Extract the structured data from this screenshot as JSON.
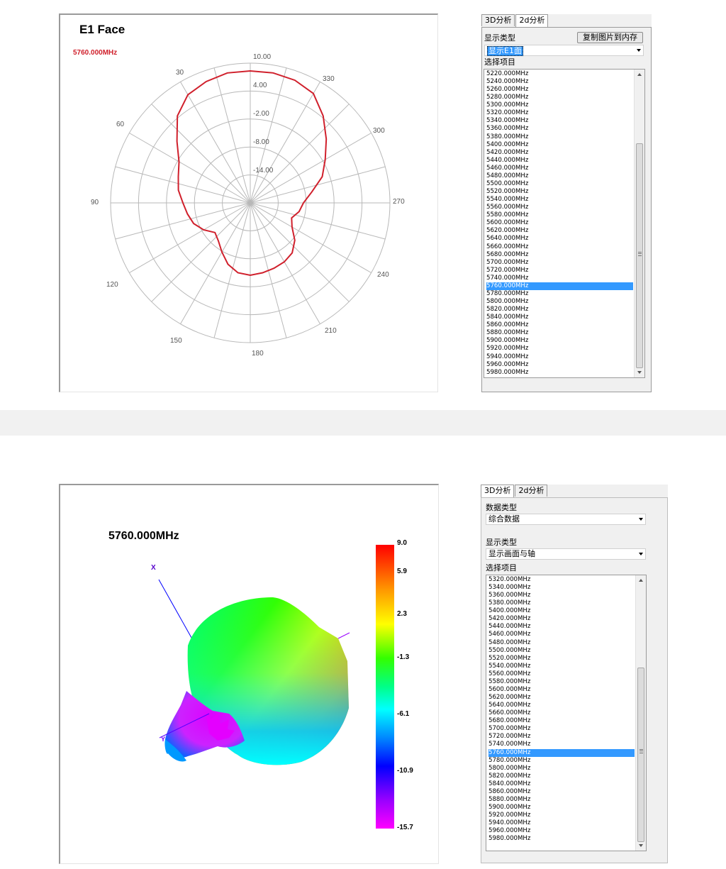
{
  "top_view": {
    "plot_title": "E1 Face",
    "frequency_label": "5760.000MHz",
    "radial_labels": [
      "10.00",
      "4.00",
      "-2.00",
      "-8.00",
      "-14.00"
    ],
    "angle_labels": [
      "30",
      "330",
      "60",
      "300",
      "90",
      "270",
      "120",
      "240",
      "150",
      "210",
      "180"
    ],
    "curve_color": "#d0202c",
    "tabs": [
      "3D分析",
      "2d分析"
    ],
    "active_tab": "2d分析",
    "display_type_label": "显示类型",
    "display_type_value": "显示E1面",
    "copy_button": "复制图片到内存",
    "select_items_label": "选择项目",
    "frequency_list": [
      "5220.000MHz",
      "5240.000MHz",
      "5260.000MHz",
      "5280.000MHz",
      "5300.000MHz",
      "5320.000MHz",
      "5340.000MHz",
      "5360.000MHz",
      "5380.000MHz",
      "5400.000MHz",
      "5420.000MHz",
      "5440.000MHz",
      "5460.000MHz",
      "5480.000MHz",
      "5500.000MHz",
      "5520.000MHz",
      "5540.000MHz",
      "5560.000MHz",
      "5580.000MHz",
      "5600.000MHz",
      "5620.000MHz",
      "5640.000MHz",
      "5660.000MHz",
      "5680.000MHz",
      "5700.000MHz",
      "5720.000MHz",
      "5740.000MHz",
      "5760.000MHz",
      "5780.000MHz",
      "5800.000MHz",
      "5820.000MHz",
      "5840.000MHz",
      "5860.000MHz",
      "5880.000MHz",
      "5900.000MHz",
      "5920.000MHz",
      "5940.000MHz",
      "5960.000MHz",
      "5980.000MHz"
    ],
    "selected_frequency": "5760.000MHz"
  },
  "bottom_view": {
    "plot_title": "5760.000MHz",
    "axis_x": "X",
    "axis_y": "Y",
    "colorbar_labels": [
      "9.0",
      "5.9",
      "2.3",
      "-1.3",
      "-6.1",
      "-10.9",
      "-15.7"
    ],
    "tabs": [
      "3D分析",
      "2d分析"
    ],
    "active_tab": "3D分析",
    "data_type_label": "数据类型",
    "data_type_value": "综合数据",
    "display_type_label": "显示类型",
    "display_type_value": "显示画面与轴",
    "select_items_label": "选择项目",
    "frequency_list": [
      "5320.000MHz",
      "5340.000MHz",
      "5360.000MHz",
      "5380.000MHz",
      "5400.000MHz",
      "5420.000MHz",
      "5440.000MHz",
      "5460.000MHz",
      "5480.000MHz",
      "5500.000MHz",
      "5520.000MHz",
      "5540.000MHz",
      "5560.000MHz",
      "5580.000MHz",
      "5600.000MHz",
      "5620.000MHz",
      "5640.000MHz",
      "5660.000MHz",
      "5680.000MHz",
      "5700.000MHz",
      "5720.000MHz",
      "5740.000MHz",
      "5760.000MHz",
      "5780.000MHz",
      "5800.000MHz",
      "5820.000MHz",
      "5840.000MHz",
      "5860.000MHz",
      "5880.000MHz",
      "5900.000MHz",
      "5920.000MHz",
      "5940.000MHz",
      "5960.000MHz",
      "5980.000MHz"
    ],
    "selected_frequency": "5760.000MHz"
  }
}
